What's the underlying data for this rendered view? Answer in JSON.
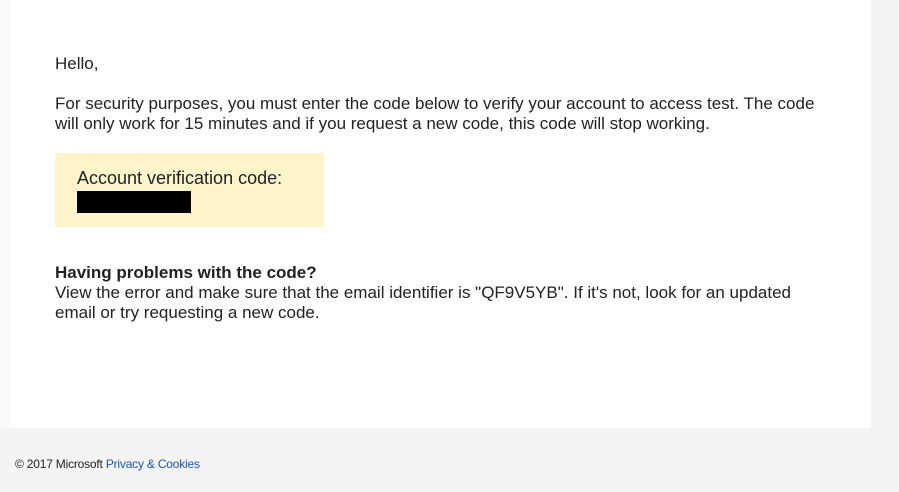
{
  "email": {
    "greeting": "Hello,",
    "intro": "For security purposes, you must enter the code below to verify your account to access test. The code will only work for 15 minutes and if you request a new code, this code will stop working.",
    "code_box": {
      "label": "Account verification code:",
      "background_color": "#fff4cc"
    },
    "problem": {
      "title": "Having problems with the code?",
      "text": "View the error and make sure that the email identifier is \"QF9V5YB\". If it's not, look for an updated email or try requesting a new code."
    }
  },
  "footer": {
    "copyright": "© 2017 Microsoft",
    "privacy_link": "Privacy & Cookies",
    "link_color": "#1a56b3"
  }
}
